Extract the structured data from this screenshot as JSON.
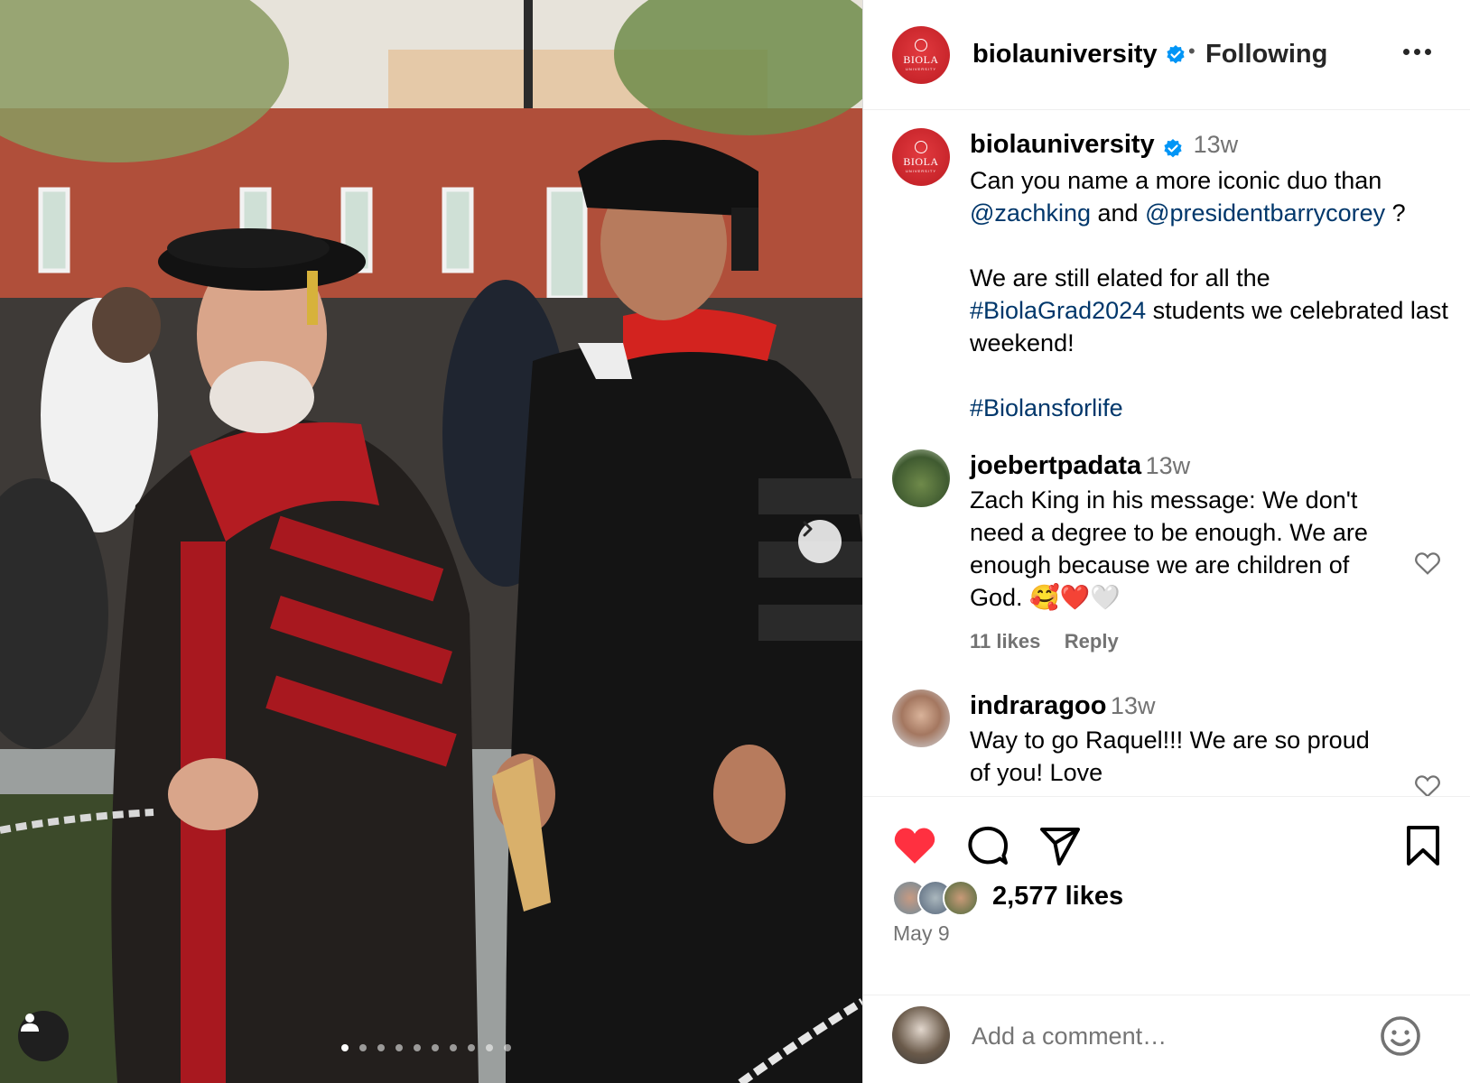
{
  "post": {
    "account": {
      "username": "biolauniversity",
      "avatar_text": "BIOLA",
      "avatar_subtext": "UNIVERSITY",
      "verified": true,
      "follow_state": "Following"
    },
    "carousel": {
      "slide_count": 10,
      "active_index": 0
    },
    "caption": {
      "username": "biolauniversity",
      "time": "13w",
      "line1_text": "Can you name a more iconic duo than",
      "mention1": "@zachking",
      "joiner": "and",
      "mention2": "@presidentbarrycorey",
      "line2_end": "?",
      "para2_text": "We are still elated for all the",
      "hashtag1": "#BiolaGrad2024",
      "para2_rest": "students we celebrated last weekend!",
      "hashtag2": "#Biolansforlife"
    },
    "comments": [
      {
        "username": "joebertpadata",
        "time": "13w",
        "text": "Zach King in his message: We don't need a degree to be enough. We are enough because we are children of God. 🥰❤️🤍",
        "likes": "11 likes",
        "reply": "Reply"
      },
      {
        "username": "indraragoo",
        "time": "13w",
        "text": "Way to go Raquel!!! We are so proud of you! Love"
      }
    ],
    "likes_text": "2,577 likes",
    "date": "May 9",
    "add_comment_placeholder": "Add a comment…"
  },
  "colors": {
    "like_red": "#ff3040",
    "link_blue": "#00376b",
    "verified_blue": "#0095f6",
    "muted_gray": "#737373"
  },
  "icons": [
    "chevron-right-icon",
    "user-tag-icon",
    "verified-badge-icon",
    "more-options-icon",
    "heart-icon",
    "comment-icon",
    "share-icon",
    "bookmark-icon",
    "emoji-icon"
  ]
}
